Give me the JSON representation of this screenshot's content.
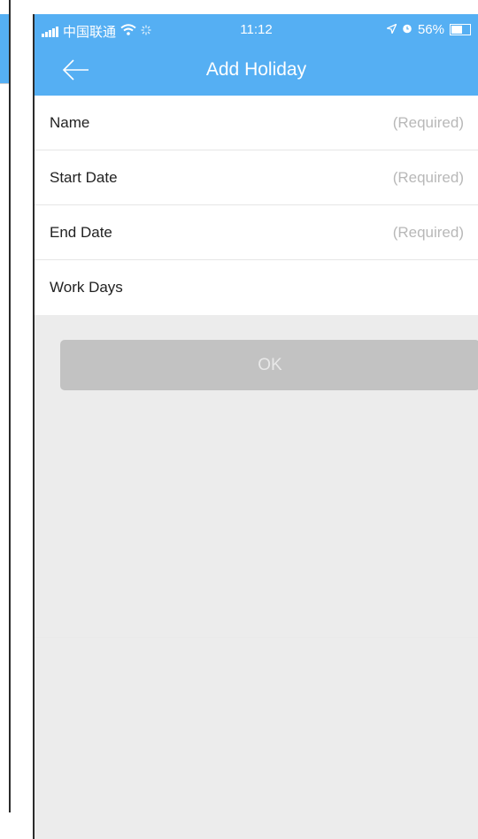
{
  "status_bar": {
    "carrier": "中国联通",
    "time": "11:12",
    "battery": "56%",
    "icons": [
      "signal-icon",
      "wifi-icon",
      "loading-icon",
      "location-icon",
      "alarm-icon",
      "battery-icon"
    ]
  },
  "nav": {
    "title": "Add Holiday",
    "back_icon": "back-arrow-icon"
  },
  "form": {
    "rows": [
      {
        "label": "Name",
        "value": "(Required)"
      },
      {
        "label": "Start Date",
        "value": "(Required)"
      },
      {
        "label": "End Date",
        "value": "(Required)"
      },
      {
        "label": "Work Days",
        "value": ""
      }
    ]
  },
  "ok_button": {
    "label": "OK"
  },
  "colors": {
    "accent": "#55aff3",
    "button_disabled": "#c2c2c2",
    "background": "#ececec",
    "placeholder": "#b8b8b8"
  }
}
